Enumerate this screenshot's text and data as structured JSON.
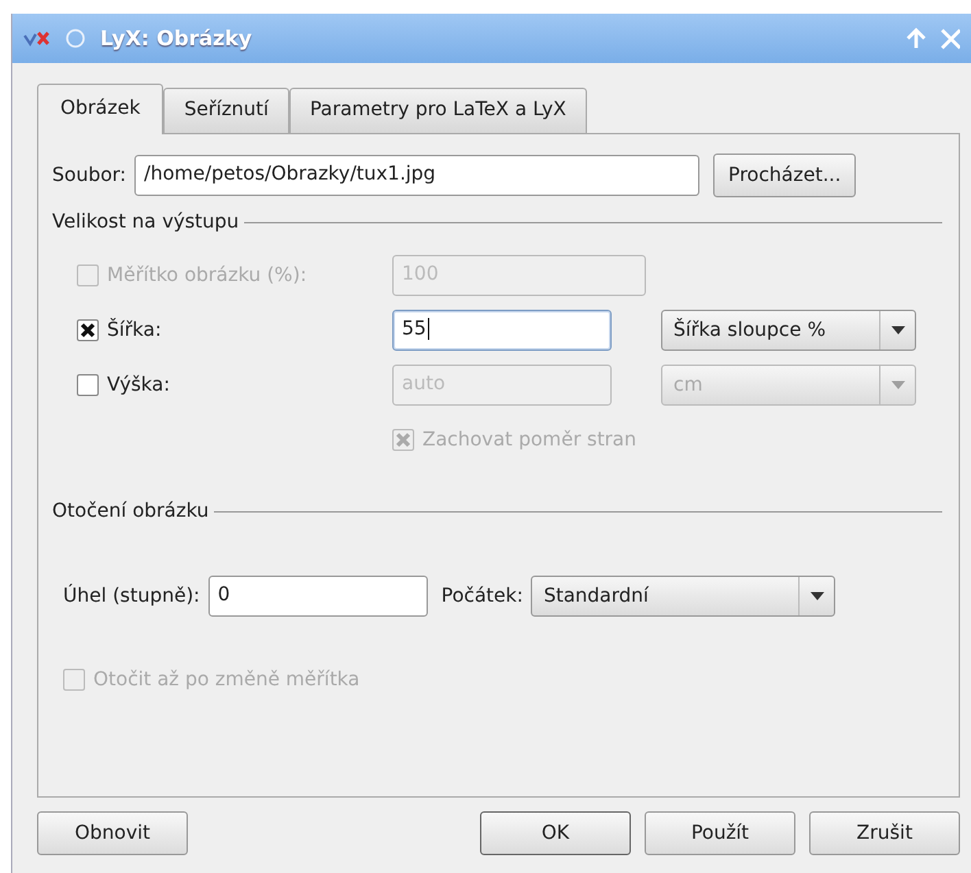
{
  "window": {
    "title": "LyX: Obrázky"
  },
  "tabs": [
    {
      "label": "Obrázek",
      "selected": true
    },
    {
      "label": "Seříznutí",
      "selected": false
    },
    {
      "label": "Parametry pro LaTeX a LyX",
      "selected": false
    }
  ],
  "file": {
    "label": "Soubor:",
    "value": "/home/petos/Obrazky/tux1.jpg",
    "browse_button": {
      "label": "Procházet..."
    }
  },
  "output_size": {
    "title": "Velikost na výstupu",
    "rows": [
      {
        "label": "Měřítko obrázku (%):",
        "checked": false,
        "disabled": true,
        "value": "100",
        "field_disabled": true,
        "focused": false
      },
      {
        "label": "Šířka:",
        "checked": true,
        "disabled": false,
        "value": "55",
        "field_disabled": false,
        "focused": true,
        "unit": {
          "value": "Šířka sloupce %",
          "disabled": false
        }
      },
      {
        "label": "Výška:",
        "checked": false,
        "disabled": false,
        "value": "auto",
        "field_disabled": true,
        "focused": false,
        "unit": {
          "value": "cm",
          "disabled": true
        }
      }
    ],
    "keep_ratio": {
      "label": "Zachovat poměr stran",
      "checked": true,
      "disabled": true
    }
  },
  "rotation": {
    "title": "Otočení obrázku",
    "angle": {
      "label": "Úhel (stupně):",
      "value": "0"
    },
    "origin": {
      "label": "Počátek:",
      "value": "Standardní"
    },
    "rotate_after_scale": {
      "label": "Otočit až po změně měřítka",
      "checked": false,
      "disabled": true
    }
  },
  "buttons": [
    {
      "label": "Obnovit",
      "kind": "reset",
      "default": false
    },
    {
      "label": "OK",
      "kind": "action",
      "default": true
    },
    {
      "label": "Použít",
      "kind": "action",
      "default": false
    },
    {
      "label": "Zrušit",
      "kind": "action",
      "default": false
    }
  ]
}
